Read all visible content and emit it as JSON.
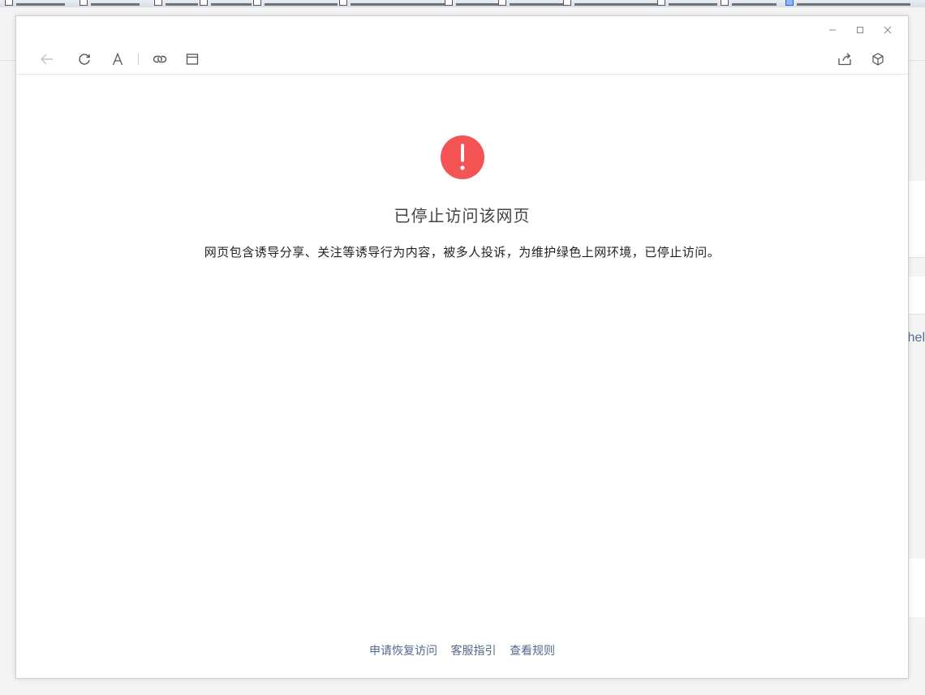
{
  "page": {
    "title": "已停止访问该网页",
    "message": "网页包含诱导分享、关注等诱导行为内容，被多人投诉，为维护绿色上网环境，已停止访问。",
    "links": [
      "申请恢复访问",
      "客服指引",
      "查看规则"
    ]
  },
  "background": {
    "partial_text": "hel"
  },
  "icons": {
    "back": "arrow-left-icon",
    "refresh": "refresh-icon",
    "font": "font-size-icon",
    "link": "link-icon",
    "window": "window-icon",
    "share": "share-icon",
    "cube": "cube-icon",
    "alert": "exclamation-circle-icon"
  },
  "colors": {
    "alert": "#f45454",
    "link": "#56698c",
    "title": "#444444"
  }
}
